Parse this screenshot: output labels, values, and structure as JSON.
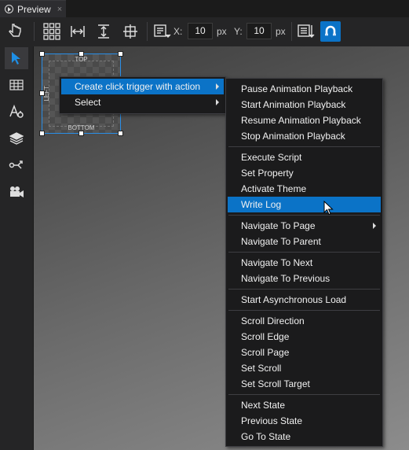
{
  "tab": {
    "title": "Preview",
    "close": "×"
  },
  "toolbar": {
    "x_label": "X:",
    "x_value": "10",
    "x_unit": "px",
    "y_label": "Y:",
    "y_value": "10",
    "y_unit": "px"
  },
  "node": {
    "top": "TOP",
    "bottom": "BOTTOM",
    "left": "LEFT"
  },
  "context_menu": {
    "items": [
      {
        "label": "Create click trigger with action"
      },
      {
        "label": "Select"
      }
    ]
  },
  "submenu": {
    "groups": [
      [
        "Pause Animation Playback",
        "Start Animation Playback",
        "Resume Animation Playback",
        "Stop Animation Playback"
      ],
      [
        "Execute Script",
        "Set Property",
        "Activate Theme",
        "Write Log"
      ],
      [
        "Navigate To Page",
        "Navigate To Parent"
      ],
      [
        "Navigate To Next",
        "Navigate To Previous"
      ],
      [
        "Start Asynchronous Load"
      ],
      [
        "Scroll Direction",
        "Scroll Edge",
        "Scroll Page",
        "Set Scroll",
        "Set Scroll Target"
      ],
      [
        "Next State",
        "Previous State",
        "Go To State"
      ]
    ]
  },
  "colors": {
    "highlight": "#0b73c7",
    "accent": "#2a8ee6"
  }
}
